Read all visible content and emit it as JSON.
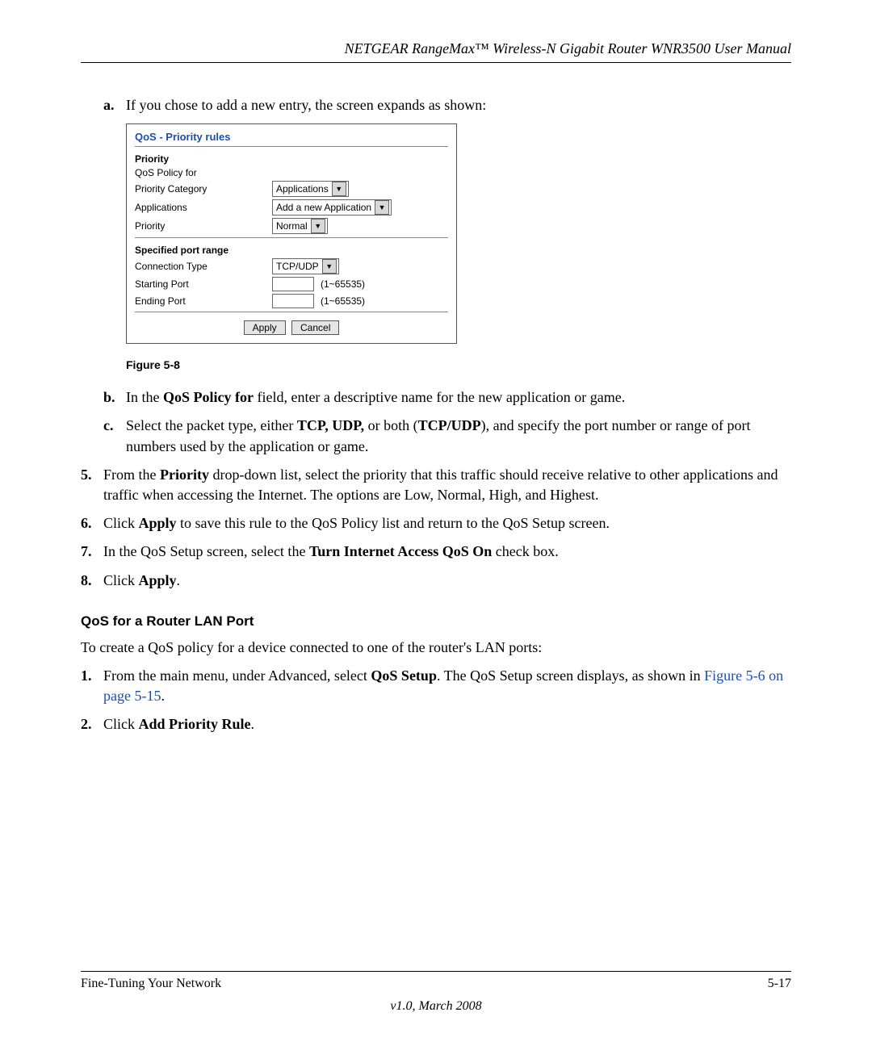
{
  "header": {
    "title": "NETGEAR RangeMax™ Wireless-N Gigabit Router WNR3500 User Manual"
  },
  "step_a": {
    "marker": "a.",
    "text": "If you chose to add a new entry, the screen expands as shown:"
  },
  "figure": {
    "title": "QoS - Priority rules",
    "section1": "Priority",
    "rows1": {
      "policy_for_label": "QoS Policy for",
      "priority_category_label": "Priority Category",
      "priority_category_value": "Applications",
      "applications_label": "Applications",
      "applications_value": "Add a new Application",
      "priority_label": "Priority",
      "priority_value": "Normal"
    },
    "section2": "Specified port range",
    "rows2": {
      "conn_type_label": "Connection Type",
      "conn_type_value": "TCP/UDP",
      "start_port_label": "Starting Port",
      "start_port_hint": "(1~65535)",
      "end_port_label": "Ending Port",
      "end_port_hint": "(1~65535)"
    },
    "buttons": {
      "apply": "Apply",
      "cancel": "Cancel"
    },
    "caption": "Figure 5-8"
  },
  "step_b": {
    "marker": "b.",
    "prefix": "In the ",
    "bold1": "QoS Policy for",
    "suffix": " field, enter a descriptive name for the new application or game."
  },
  "step_c": {
    "marker": "c.",
    "t1": "Select the packet type, either ",
    "b1": "TCP, UDP,",
    "t2": " or both (",
    "b2": "TCP/UDP",
    "t3": "), and specify the port number or range of port numbers used by the application or game."
  },
  "step5": {
    "marker": "5.",
    "t1": "From the ",
    "b1": "Priority",
    "t2": " drop-down list, select the priority that this traffic should receive relative to other applications and traffic when accessing the Internet. The options are Low, Normal, High, and Highest."
  },
  "step6": {
    "marker": "6.",
    "t1": "Click ",
    "b1": "Apply",
    "t2": " to save this rule to the QoS Policy list and return to the QoS Setup screen."
  },
  "step7": {
    "marker": "7.",
    "t1": "In the QoS Setup screen, select the ",
    "b1": "Turn Internet Access QoS On",
    "t2": " check box."
  },
  "step8": {
    "marker": "8.",
    "t1": "Click ",
    "b1": "Apply",
    "t2": "."
  },
  "section2": {
    "heading": "QoS for a Router LAN Port",
    "intro": "To create a QoS policy for a device connected to one of the router's LAN ports:"
  },
  "s2_step1": {
    "marker": "1.",
    "t1": "From the main menu, under Advanced, select ",
    "b1": "QoS Setup",
    "t2": ". The QoS Setup screen displays, as shown in ",
    "link": "Figure 5-6 on page 5-15",
    "t3": "."
  },
  "s2_step2": {
    "marker": "2.",
    "t1": "Click ",
    "b1": "Add Priority Rule",
    "t2": "."
  },
  "footer": {
    "left": "Fine-Tuning Your Network",
    "right": "5-17",
    "version": "v1.0, March 2008"
  }
}
